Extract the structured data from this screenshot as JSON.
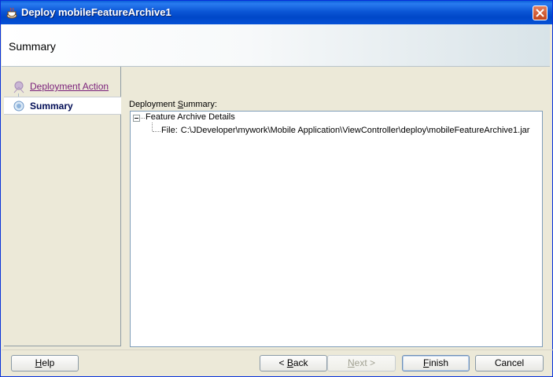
{
  "window": {
    "title": "Deploy mobileFeatureArchive1",
    "icon": "java-cup-icon"
  },
  "header": {
    "title": "Summary"
  },
  "nav": {
    "items": [
      {
        "label": "Deployment Action",
        "state": "visited",
        "icon": "step-node-icon"
      },
      {
        "label": "Summary",
        "state": "selected",
        "icon": "current-step-icon"
      }
    ]
  },
  "summary": {
    "label_prefix": "Deployment ",
    "label_mnemonic": "S",
    "label_suffix": "ummary:",
    "tree": {
      "root": "Feature Archive Details",
      "child_key": "File:",
      "child_value": "C:\\JDeveloper\\mywork\\Mobile Application\\ViewController\\deploy\\mobileFeatureArchive1.jar"
    }
  },
  "buttons": {
    "help": {
      "m": "H",
      "rest": "elp"
    },
    "back": {
      "pre": "< ",
      "m": "B",
      "rest": "ack"
    },
    "next": {
      "m": "N",
      "rest": "ext >"
    },
    "finish": {
      "m": "F",
      "rest": "inish"
    },
    "cancel": "Cancel"
  },
  "colors": {
    "titlebar": "#0b56d6",
    "link": "#7a1f7a",
    "selected_text": "#000c55"
  }
}
